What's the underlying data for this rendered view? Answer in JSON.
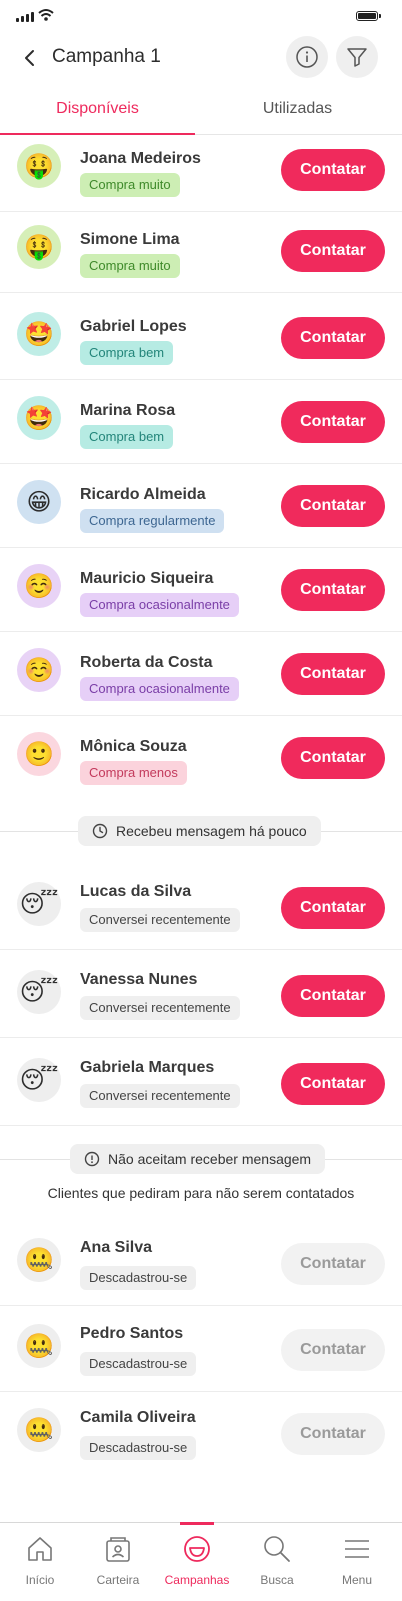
{
  "header": {
    "title": "Campanha 1"
  },
  "tabs": [
    {
      "label": "Disponíveis"
    },
    {
      "label": "Utilizadas"
    }
  ],
  "available": [
    {
      "name": "Joana Medeiros",
      "tag": "Compra muito",
      "emoji": "🤑",
      "avatar_bg": "#d6efb8",
      "tag_bg": "#cdeeb4",
      "tag_fg": "#3f8a2a",
      "button": "Contatar"
    },
    {
      "name": "Simone Lima",
      "tag": "Compra muito",
      "emoji": "🤑",
      "avatar_bg": "#d6efb8",
      "tag_bg": "#cdeeb4",
      "tag_fg": "#3f8a2a",
      "button": "Contatar"
    },
    {
      "name": "Gabriel Lopes",
      "tag": "Compra bem",
      "emoji": "🤩",
      "avatar_bg": "#bfede6",
      "tag_bg": "#b6ebe3",
      "tag_fg": "#23857a",
      "button": "Contatar"
    },
    {
      "name": "Marina Rosa",
      "tag": "Compra bem",
      "emoji": "🤩",
      "avatar_bg": "#bfede6",
      "tag_bg": "#b6ebe3",
      "tag_fg": "#23857a",
      "button": "Contatar"
    },
    {
      "name": "Ricardo Almeida",
      "tag": "Compra regularmente",
      "emoji": "😁",
      "avatar_bg": "#cfe1f1",
      "tag_bg": "#cfe0f1",
      "tag_fg": "#3d6691",
      "button": "Contatar"
    },
    {
      "name": "Mauricio Siqueira",
      "tag": "Compra ocasionalmente",
      "emoji": "☺️",
      "avatar_bg": "#e8d3f6",
      "tag_bg": "#e6cff7",
      "tag_fg": "#7a3ea7",
      "button": "Contatar"
    },
    {
      "name": "Roberta da Costa",
      "tag": "Compra ocasionalmente",
      "emoji": "☺️",
      "avatar_bg": "#e8d3f6",
      "tag_bg": "#e6cff7",
      "tag_fg": "#7a3ea7",
      "button": "Contatar"
    },
    {
      "name": "Mônica Souza",
      "tag": "Compra menos",
      "emoji": "🙂",
      "avatar_bg": "#fbd7df",
      "tag_bg": "#fbd3dc",
      "tag_fg": "#c33a5c",
      "button": "Contatar"
    }
  ],
  "recent_section": {
    "label": "Recebeu mensagem há pouco"
  },
  "recent": [
    {
      "name": "Lucas da Silva",
      "tag": "Conversei recentemente",
      "emoji": "😴",
      "button": "Contatar"
    },
    {
      "name": "Vanessa Nunes",
      "tag": "Conversei recentemente",
      "emoji": "😴",
      "button": "Contatar"
    },
    {
      "name": "Gabriela Marques",
      "tag": "Conversei recentemente",
      "emoji": "😴",
      "button": "Contatar"
    }
  ],
  "optout_section": {
    "label": "Não aceitam receber mensagem",
    "note": "Clientes que pediram para não serem contatados"
  },
  "optout": [
    {
      "name": "Ana Silva",
      "tag": "Descadastrou-se",
      "emoji": "🤐",
      "button": "Contatar"
    },
    {
      "name": "Pedro Santos",
      "tag": "Descadastrou-se",
      "emoji": "🤐",
      "button": "Contatar"
    },
    {
      "name": "Camila Oliveira",
      "tag": "Descadastrou-se",
      "emoji": "🤐",
      "button": "Contatar"
    }
  ],
  "bottom_nav": [
    {
      "label": "Início",
      "icon": "home-icon"
    },
    {
      "label": "Carteira",
      "icon": "wallet-icon"
    },
    {
      "label": "Campanhas",
      "icon": "campaigns-icon",
      "active": true
    },
    {
      "label": "Busca",
      "icon": "search-icon"
    },
    {
      "label": "Menu",
      "icon": "menu-icon"
    }
  ],
  "colors": {
    "accent": "#ee2a5d",
    "neutral_tag_bg": "#efefef",
    "disabled_button_bg": "#f2f2f2"
  }
}
